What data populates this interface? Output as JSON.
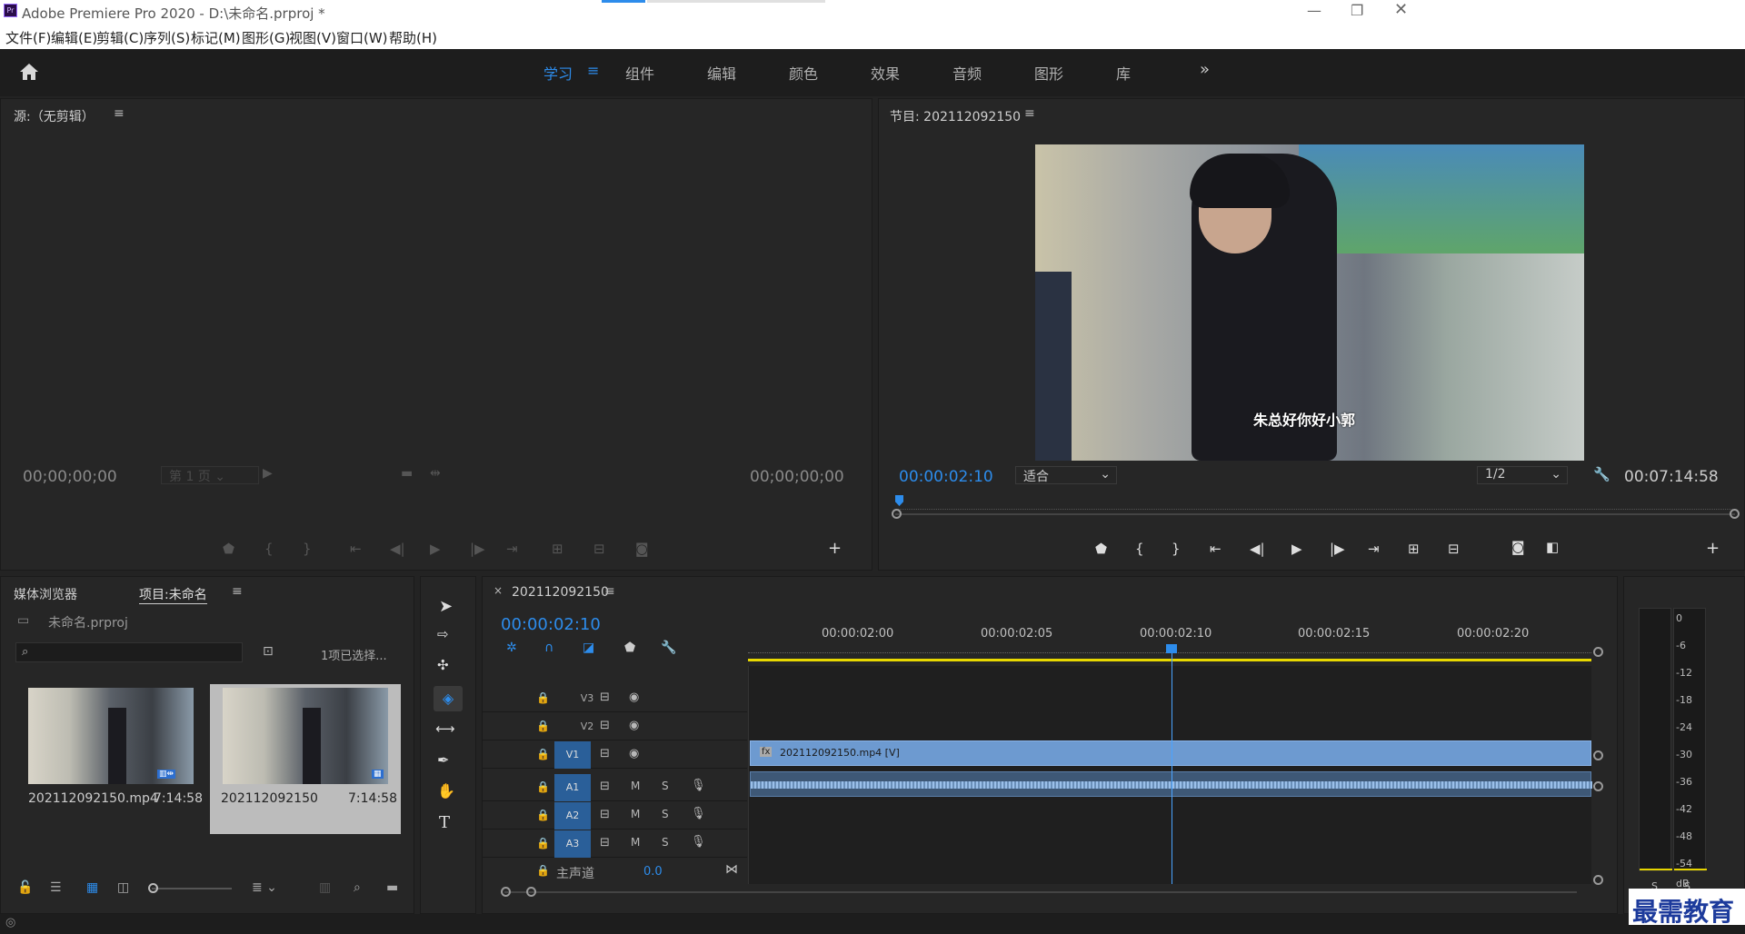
{
  "window": {
    "title": "Adobe Premiere Pro 2020 - D:\\未命名.prproj *",
    "minimize_icon": "minimize-icon",
    "maximize_icon": "restore-icon",
    "close_icon": "close-icon"
  },
  "menu": [
    "文件(F)",
    "编辑(E)",
    "剪辑(C)",
    "序列(S)",
    "标记(M)",
    "图形(G)",
    "视图(V)",
    "窗口(W)",
    "帮助(H)"
  ],
  "workspaces": {
    "tabs": [
      "学习",
      "组件",
      "编辑",
      "颜色",
      "效果",
      "音频",
      "图形",
      "库"
    ],
    "active": "学习",
    "accent": "#2d8ceb"
  },
  "source": {
    "title": "源:（无剪辑）",
    "timecode_left": "00;00;00;00",
    "timecode_right": "00;00;00;00",
    "page_select": "第 1 页"
  },
  "program": {
    "title": "节目: 202112092150",
    "timecode": "00:00:02:10",
    "fit": "适合",
    "resolution": "1/2",
    "duration": "00:07:14:58",
    "subtitle": "朱总好你好小郭",
    "playhead_position": 0.0
  },
  "project": {
    "tab_media": "媒体浏览器",
    "tab_project": "项目:未命名",
    "filename": "未命名.prproj",
    "selection": "1项已选择...",
    "items": [
      {
        "name": "202112092150.mp4",
        "duration": "7:14:58"
      },
      {
        "name": "202112092150",
        "duration": "7:14:58"
      }
    ]
  },
  "timeline": {
    "sequence": "202112092150",
    "timecode": "00:00:02:10",
    "ruler": [
      "00:00:02:00",
      "00:00:02:05",
      "00:00:02:10",
      "00:00:02:15",
      "00:00:02:20"
    ],
    "video_tracks": [
      "V3",
      "V2",
      "V1"
    ],
    "audio_tracks": [
      "A1",
      "A2",
      "A3"
    ],
    "track_m": "M",
    "track_s": "S",
    "master": "主声道",
    "master_value": "0.0",
    "clip_name": "202112092150.mp4 [V]"
  },
  "meters": {
    "scale": [
      "0",
      "-6",
      "-12",
      "-18",
      "-24",
      "-30",
      "-36",
      "-42",
      "-48",
      "-54",
      "dB"
    ],
    "solo": [
      "S",
      "S"
    ]
  },
  "watermark": "最需教育"
}
